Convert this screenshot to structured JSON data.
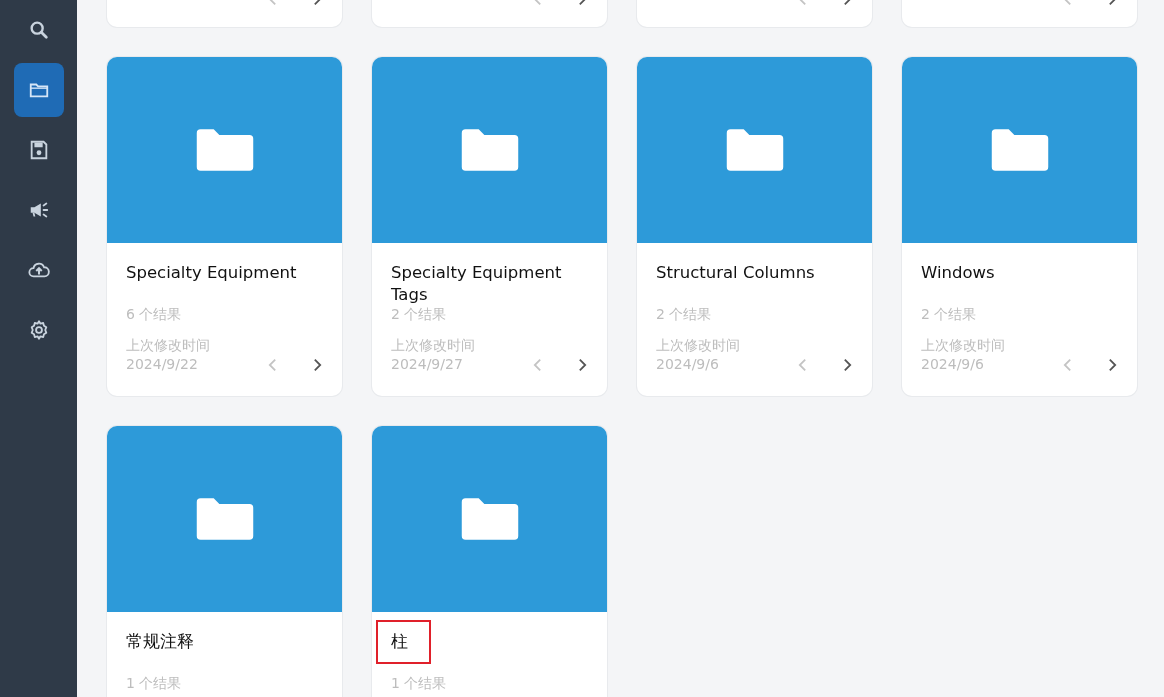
{
  "sidebar": {
    "items": [
      {
        "selected": false
      },
      {
        "selected": true
      },
      {
        "selected": false
      },
      {
        "selected": false
      },
      {
        "selected": false
      },
      {
        "selected": false
      }
    ]
  },
  "partial_cards": [
    {
      "kind": "card-bottom"
    },
    {
      "kind": "card-bottom"
    },
    {
      "kind": "card-bottom"
    },
    {
      "kind": "card-bottom"
    }
  ],
  "cards": [
    {
      "title": "Specialty Equipment",
      "count": "6 个结果",
      "modified_label": "上次修改时间",
      "date": "2024/9/22",
      "highlighted": false
    },
    {
      "title": "Specialty Equipment Tags",
      "count": "2 个结果",
      "modified_label": "上次修改时间",
      "date": "2024/9/27",
      "highlighted": false
    },
    {
      "title": "Structural Columns",
      "count": "2 个结果",
      "modified_label": "上次修改时间",
      "date": "2024/9/6",
      "highlighted": false
    },
    {
      "title": "Windows",
      "count": "2 个结果",
      "modified_label": "上次修改时间",
      "date": "2024/9/6",
      "highlighted": false
    },
    {
      "title": "常规注释",
      "count": "1 个结果",
      "highlighted": false
    },
    {
      "title": "柱",
      "count": "1 个结果",
      "highlighted": true
    }
  ]
}
